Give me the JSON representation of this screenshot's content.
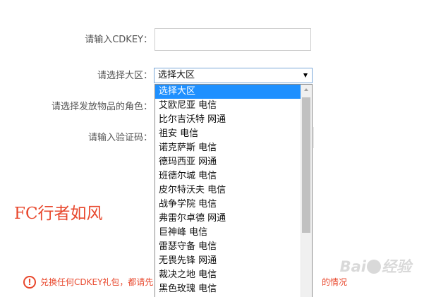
{
  "form": {
    "cdkey": {
      "label": "请输入CDKEY：",
      "value": ""
    },
    "server": {
      "label": "请选择大区：",
      "selected": "选择大区",
      "options": [
        "选择大区",
        "艾欧尼亚 电信",
        "比尔吉沃特 网通",
        "祖安 电信",
        "诺克萨斯 电信",
        "德玛西亚 网通",
        "班德尔城 电信",
        "皮尔特沃夫 电信",
        "战争学院 电信",
        "弗雷尔卓德 网通",
        "巨神峰 电信",
        "雷瑟守备 电信",
        "无畏先锋 网通",
        "裁决之地 电信",
        "黑色玫瑰 电信"
      ]
    },
    "role": {
      "label": "请选择发放物品的角色："
    },
    "captcha": {
      "label": "请输入验证码："
    }
  },
  "brand": {
    "text": "FC行者如风",
    "color": "#e8472c"
  },
  "notice": {
    "icon": "exclamation-circle-icon",
    "text_left": "兑换任何CDKEY礼包，都请先",
    "text_right": "的情况",
    "color": "#e8472c"
  },
  "watermark": {
    "text_left": "Bai",
    "text_right": "经验"
  },
  "colors": {
    "selected_option_bg": "#1e90ff",
    "select_border": "#7aa7d8"
  }
}
